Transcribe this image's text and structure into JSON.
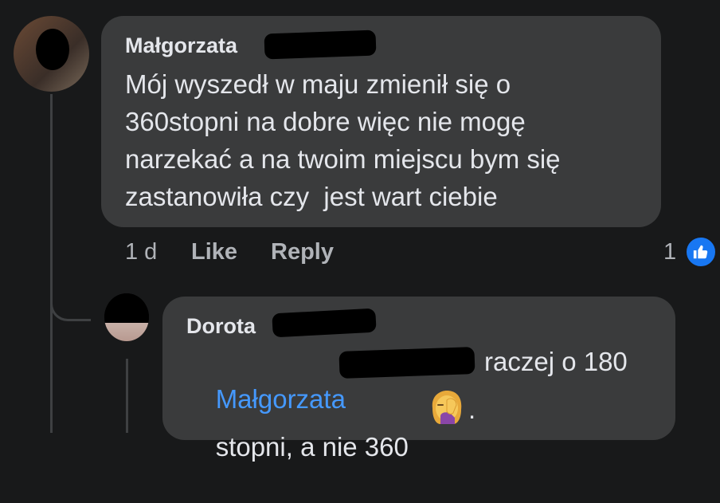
{
  "comment": {
    "author": "Małgorzata",
    "lines": [
      "Mój wyszedł w maju zmienił się o",
      "360stopni na dobre więc nie mogę",
      "narzekać a na twoim miejscu bym się",
      "zastanowiła czy  jest wart ciebie"
    ],
    "time": "1 d",
    "like_label": "Like",
    "reply_label": "Reply",
    "reaction_count": "1",
    "reaction_icon": "thumbs-up-icon"
  },
  "reply": {
    "author": "Dorota",
    "mention": "Małgorzata",
    "line1_rest": "raczej o 180",
    "line2": "stopni, a nie 360",
    "emoji": "face-palm-woman-emoji",
    "line2_end": "."
  },
  "colors": {
    "background": "#18191a",
    "bubble": "#3a3b3c",
    "mention": "#4599ff",
    "like_badge": "#1877f2"
  }
}
